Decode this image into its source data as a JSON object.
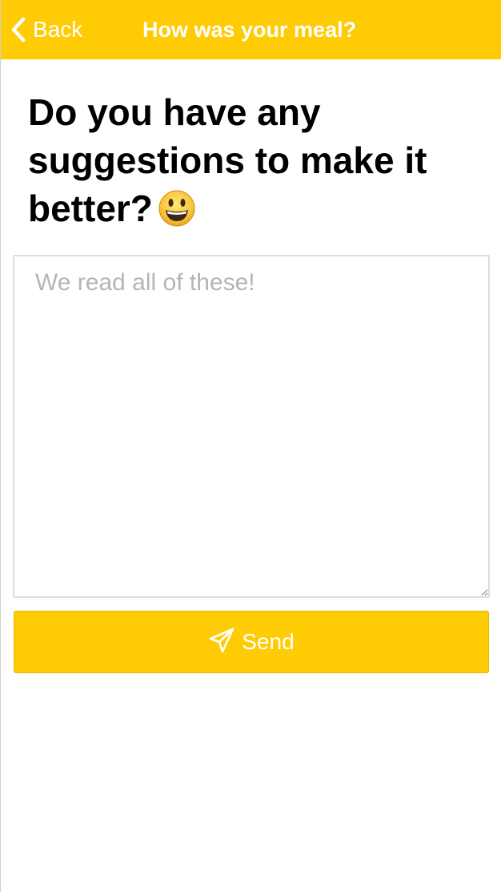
{
  "nav": {
    "back_label": "Back",
    "title": "How was your meal?"
  },
  "main": {
    "question": "Do you have any suggestions to make it better?",
    "emoji_icon": "grinning-face-emoji",
    "feedback_value": "",
    "feedback_placeholder": "We read all of these!",
    "send_label": "Send",
    "send_icon": "paper-plane-icon"
  },
  "colors": {
    "accent": "#ffcb05",
    "text": "#000000",
    "placeholder": "#b5b5b5",
    "on_accent": "#ffffff"
  }
}
